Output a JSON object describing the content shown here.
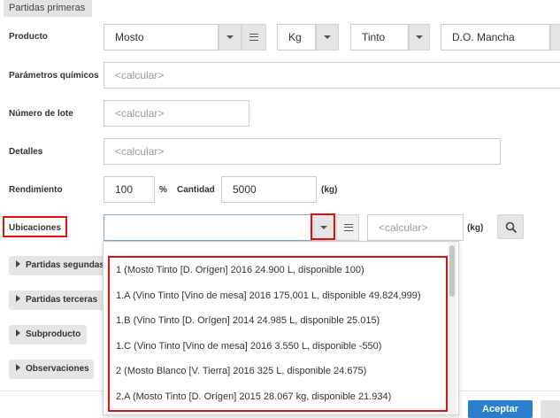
{
  "header": {
    "title": "Partidas primeras"
  },
  "producto": {
    "label": "Producto",
    "value": "Mosto",
    "unit": "Kg",
    "tipo": "Tinto",
    "do": "D.O. Mancha"
  },
  "parametros": {
    "label": "Parámetros químicos",
    "placeholder": "<calcular>"
  },
  "lote": {
    "label": "Número de lote",
    "placeholder": "<calcular>"
  },
  "detalles": {
    "label": "Detalles",
    "placeholder": "<calcular>"
  },
  "rendimiento": {
    "label": "Rendimiento",
    "value": "100",
    "unit": "%",
    "cantidad_label": "Cantidad",
    "cantidad_value": "5000",
    "cantidad_unit": "(kg)"
  },
  "ubicaciones": {
    "label": "Ubicaciones",
    "value": "",
    "qty_placeholder": "<calcular>",
    "qty_unit": "(kg)"
  },
  "sections": [
    "Partidas segundas",
    "Partidas terceras",
    "Subproducto",
    "Observaciones"
  ],
  "dropdown_options": [
    "1 (Mosto Tinto [D. Orígen] 2016 24.900 L, disponible 100)",
    "1.A (Vino Tinto [Vino de mesa] 2016 175,001 L, disponible 49.824,999)",
    "1.B (Vino Tinto [D. Orígen] 2014 24.985 L, disponible 25.015)",
    "1.C (Vino Tinto [Vino de mesa] 2016 3.550 L, disponible -550)",
    "2 (Mosto Blanco [V. Tierra] 2016 325 L, disponible 24.675)",
    "2.A (Mosto Tinto [D. Orígen] 2015 28.067 kg, disponible 21.934)"
  ],
  "footer": {
    "accept_label": "Aceptar"
  },
  "colors": {
    "highlight": "#e01010",
    "primary": "#2b7fd0"
  }
}
